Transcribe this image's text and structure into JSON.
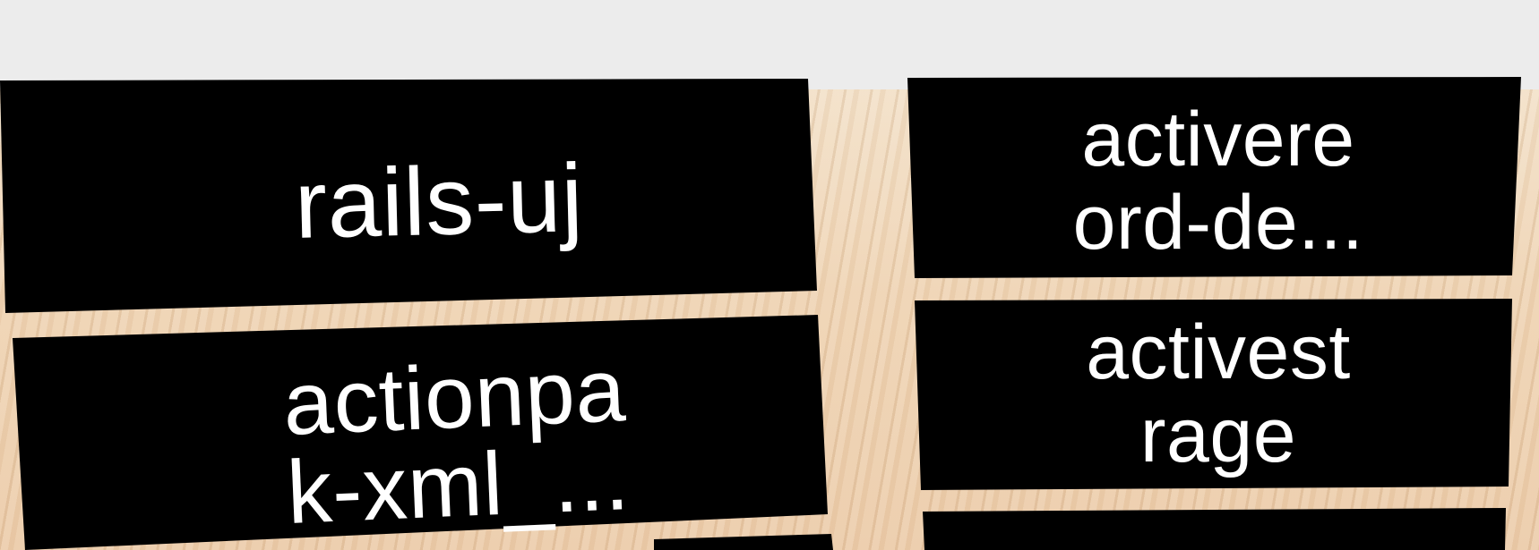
{
  "scene": {
    "background_colors": {
      "sky": "#ececec",
      "floor": "#efd4b4",
      "tile": "#000000",
      "text": "#ffffff"
    }
  },
  "tiles": [
    {
      "label": "rails-uj"
    },
    {
      "label": "actionpa\nk-xml_..."
    },
    {
      "label": "activere\nord-de..."
    },
    {
      "label": "activest\nrage"
    }
  ]
}
